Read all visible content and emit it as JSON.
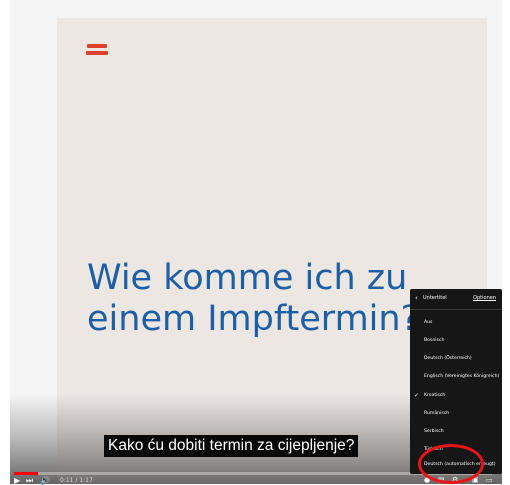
{
  "video": {
    "title_line1": "Wie komme ich zu",
    "title_line2": "einem Impftermin?",
    "caption": "Kako ću dobiti termin za cijepljenje?",
    "progress": 0.05,
    "time": "0:11 / 1:17",
    "brand_color": "#e2402b",
    "title_color": "#1d5fa6"
  },
  "controls": {
    "play_icon": "play-icon",
    "next_icon": "next-icon",
    "volume_icon": "volume-icon"
  },
  "subtitles_menu": {
    "back_icon": "chevron-left-icon",
    "title": "Untertitel",
    "options_label": "Optionen",
    "items": [
      {
        "label": "Aus",
        "selected": false
      },
      {
        "label": "Bosnisch",
        "selected": false
      },
      {
        "label": "Deutsch (Österreich)",
        "selected": false
      },
      {
        "label": "Englisch (Vereinigtes Königreich)",
        "selected": false
      },
      {
        "label": "Kroatisch",
        "selected": true
      },
      {
        "label": "Rumänisch",
        "selected": false
      },
      {
        "label": "Serbisch",
        "selected": false
      },
      {
        "label": "Türkisch",
        "selected": false
      },
      {
        "label": "Deutsch (automatisch erzeugt)",
        "selected": false
      }
    ]
  },
  "highlight_color": "#e81416"
}
